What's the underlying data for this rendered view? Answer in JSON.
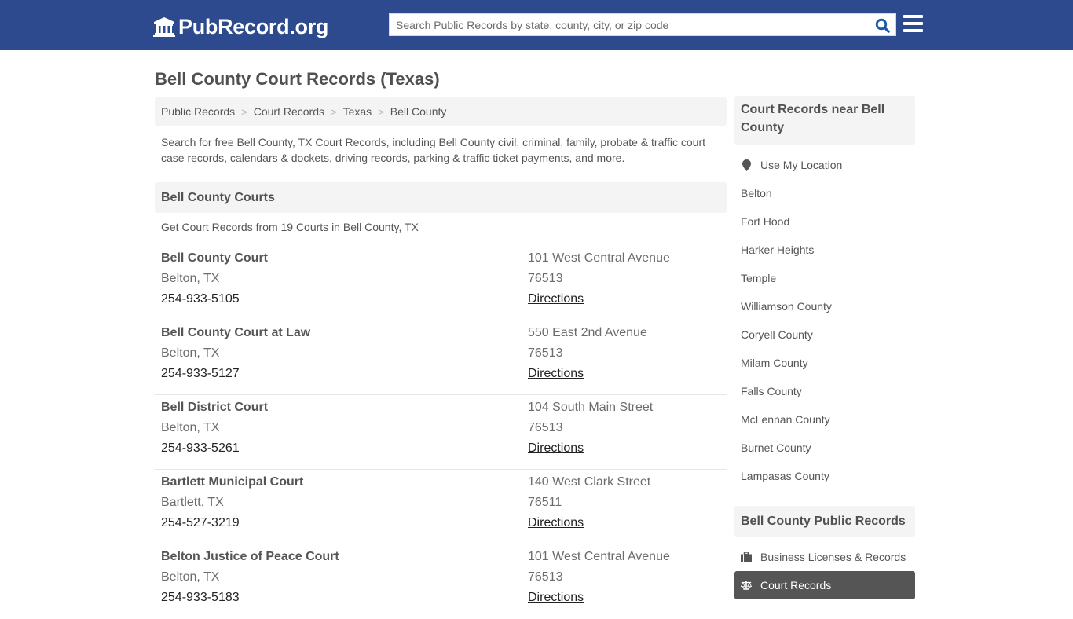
{
  "header": {
    "logo_text": "PubRecord.org",
    "logo_icon": "courthouse-icon",
    "search_placeholder": "Search Public Records by state, county, city, or zip code",
    "search_value": "",
    "search_icon": "search-icon",
    "menu_icon": "hamburger-menu-icon",
    "brand_color": "#2d4a8f",
    "accent_color": "#1a5aa6"
  },
  "page": {
    "title": "Bell County Court Records (Texas)",
    "breadcrumb": [
      "Public Records",
      "Court Records",
      "Texas",
      "Bell County"
    ],
    "breadcrumb_separator": ">",
    "intro": "Search for free Bell County, TX Court Records, including Bell County civil, criminal, family, probate & traffic court case records, calendars & dockets, driving records, parking & traffic ticket payments, and more."
  },
  "courts_section": {
    "heading": "Bell County Courts",
    "subheading": "Get Court Records from 19 Courts in Bell County, TX",
    "courts": [
      {
        "name": "Bell County Court",
        "city": "Belton, TX",
        "phone": "254-933-5105",
        "address": "101 West Central Avenue",
        "zip": "76513",
        "directions": "Directions"
      },
      {
        "name": "Bell County Court at Law",
        "city": "Belton, TX",
        "phone": "254-933-5127",
        "address": "550 East 2nd Avenue",
        "zip": "76513",
        "directions": "Directions"
      },
      {
        "name": "Bell District Court",
        "city": "Belton, TX",
        "phone": "254-933-5261",
        "address": "104 South Main Street",
        "zip": "76513",
        "directions": "Directions"
      },
      {
        "name": "Bartlett Municipal Court",
        "city": "Bartlett, TX",
        "phone": "254-527-3219",
        "address": "140 West Clark Street",
        "zip": "76511",
        "directions": "Directions"
      },
      {
        "name": "Belton Justice of Peace Court",
        "city": "Belton, TX",
        "phone": "254-933-5183",
        "address": "101 West Central Avenue",
        "zip": "76513",
        "directions": "Directions"
      }
    ]
  },
  "sidebar": {
    "nearby_heading": "Court Records near Bell County",
    "use_location": "Use My Location",
    "use_location_icon": "map-marker-icon",
    "nearby": [
      "Belton",
      "Fort Hood",
      "Harker Heights",
      "Temple",
      "Williamson County",
      "Coryell County",
      "Milam County",
      "Falls County",
      "McLennan County",
      "Burnet County",
      "Lampasas County"
    ],
    "public_records_heading": "Bell County Public Records",
    "public_records": [
      {
        "label": "Business Licenses & Records",
        "icon": "briefcase-icon",
        "active": false
      },
      {
        "label": "Court Records",
        "icon": "scales-icon",
        "active": true
      }
    ]
  }
}
